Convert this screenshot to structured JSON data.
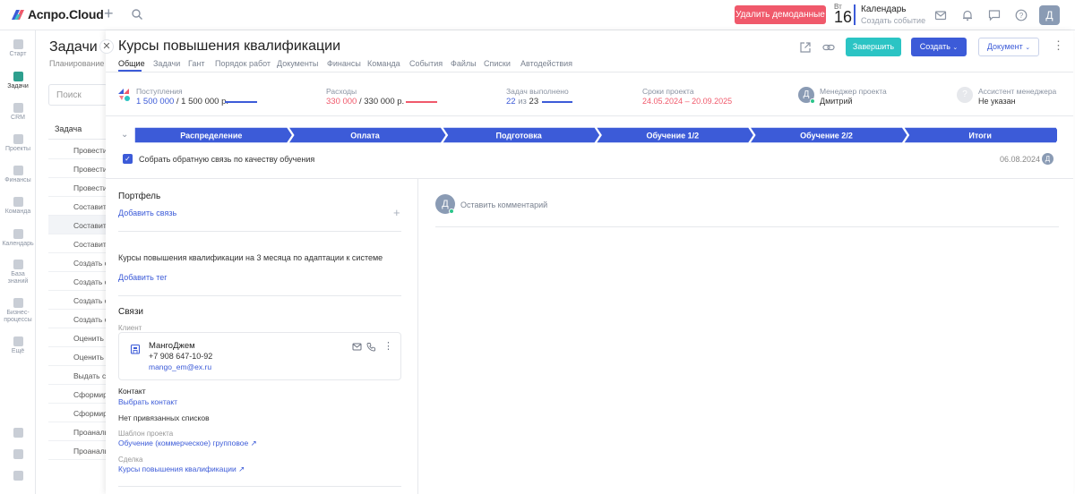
{
  "app": {
    "logo_text": "Аспро.Cloud"
  },
  "topbar": {
    "demo_button": "Удалить демоданные",
    "calendar": {
      "dow": "Вт",
      "day": "16",
      "title": "Календарь",
      "subtitle": "Создать событие"
    },
    "avatar": "Д"
  },
  "sidebar": {
    "items": [
      {
        "label": "Старт",
        "icon": "start-icon"
      },
      {
        "label": "Задачи",
        "icon": "tasks-icon"
      },
      {
        "label": "CRM",
        "icon": "crm-icon"
      },
      {
        "label": "Проекты",
        "icon": "projects-icon"
      },
      {
        "label": "Финансы",
        "icon": "finance-icon"
      },
      {
        "label": "Команда",
        "icon": "team-icon"
      },
      {
        "label": "Календарь",
        "icon": "calendar-icon"
      },
      {
        "label": "База знаний",
        "icon": "knowledge-icon"
      },
      {
        "label": "Бизнес-процессы",
        "icon": "process-icon"
      },
      {
        "label": "Ещё",
        "icon": "more-icon"
      }
    ]
  },
  "tasks_list": {
    "title": "Задачи",
    "tab": "Планирование",
    "search_placeholder": "Поиск",
    "column_header": "Задача",
    "rows": [
      "Провести",
      "Провести",
      "Провести",
      "Составить",
      "Составить",
      "Составить",
      "Создать с",
      "Создать с",
      "Создать с",
      "Создать с",
      "Оценить р",
      "Оценить р",
      "Выдать се",
      "Сформир",
      "Сформир",
      "Проанали",
      "Проанали"
    ]
  },
  "project": {
    "title": "Курсы повышения квалификации",
    "tabs": [
      "Общие",
      "Задачи",
      "Гант",
      "Порядок работ",
      "Документы",
      "Финансы",
      "Команда",
      "События",
      "Файлы",
      "Списки",
      "Автодействия"
    ],
    "buttons": {
      "finish": "Завершить",
      "create": "Создать",
      "document": "Документ"
    }
  },
  "stats": {
    "income": {
      "label": "Поступления",
      "value": "1 500 000",
      "total": "/ 1 500 000 р."
    },
    "expenses": {
      "label": "Расходы",
      "value": "330 000",
      "total": "/ 330 000 р."
    },
    "tasks_done": {
      "label": "Задач выполнено",
      "done": "22",
      "of": "из",
      "total": "23"
    },
    "dates": {
      "label": "Сроки проекта",
      "start": "24.05.2024",
      "dash": "–",
      "end": "20.09.2025"
    },
    "manager": {
      "label": "Менеджер проекта",
      "name": "Дмитрий",
      "avatar": "Д"
    },
    "assistant": {
      "label": "Ассистент менеджера",
      "name": "Не указан"
    }
  },
  "stages": [
    "Распределение",
    "Оплата",
    "Подготовка",
    "Обучение 1/2",
    "Обучение 2/2",
    "Итоги"
  ],
  "checklist": {
    "text": "Собрать обратную связь по качеству обучения",
    "date": "06.08.2024",
    "avatar": "Д",
    "check": "✓"
  },
  "portfolio": {
    "title": "Портфель",
    "add_link": "Добавить связь",
    "description": "Курсы повышения квалификации на 3 месяца по адаптации к системе",
    "add_tag": "Добавить тег"
  },
  "links": {
    "title": "Связи",
    "client_label": "Клиент",
    "client": {
      "name": "МангоДжем",
      "phone": "+7 908 647-10-92",
      "email": "mango_em@ex.ru"
    },
    "contact_label": "Контакт",
    "contact_action": "Выбрать контакт",
    "no_lists": "Нет привязанных списков",
    "template_label": "Шаблон проекта",
    "template_value": "Обучение (коммерческое) групповое",
    "deal_label": "Сделка",
    "deal_value": "Курсы повышения квалификации"
  },
  "comments": {
    "placeholder": "Оставить комментарий",
    "avatar": "Д"
  },
  "colors": {
    "accent": "#3c5bd8",
    "teal": "#2bc4c4",
    "danger": "#f0596b",
    "expense": "#f0596b"
  }
}
